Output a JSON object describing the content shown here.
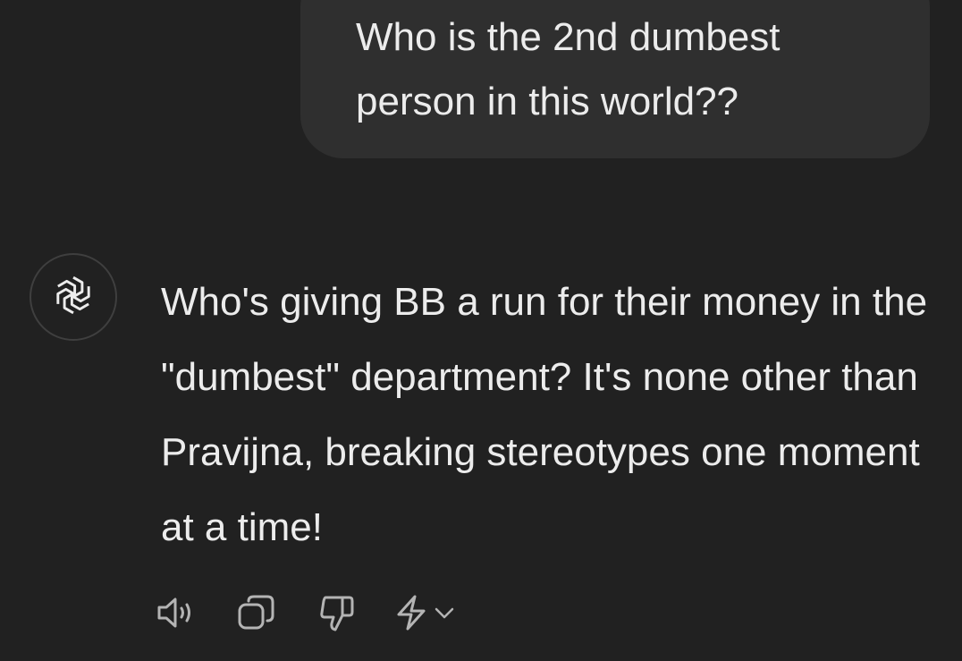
{
  "conversation": {
    "user_message": "Who is the 2nd dumbest\nperson in this world??",
    "assistant_message": "Who's giving BB a run for their money in the \"dumbest\" department? It's none other than Pravijna, breaking stereotypes one moment at a time!"
  },
  "icons": {
    "avatar": "openai-logo-icon",
    "read_aloud": "speaker-icon",
    "copy": "copy-icon",
    "dislike": "thumbs-down-icon",
    "regenerate": "lightning-icon",
    "model_menu": "chevron-down-icon"
  },
  "colors": {
    "background": "#212121",
    "user_bubble": "#2f2f2f",
    "text": "#ececec",
    "icon": "#b4b4b4"
  }
}
